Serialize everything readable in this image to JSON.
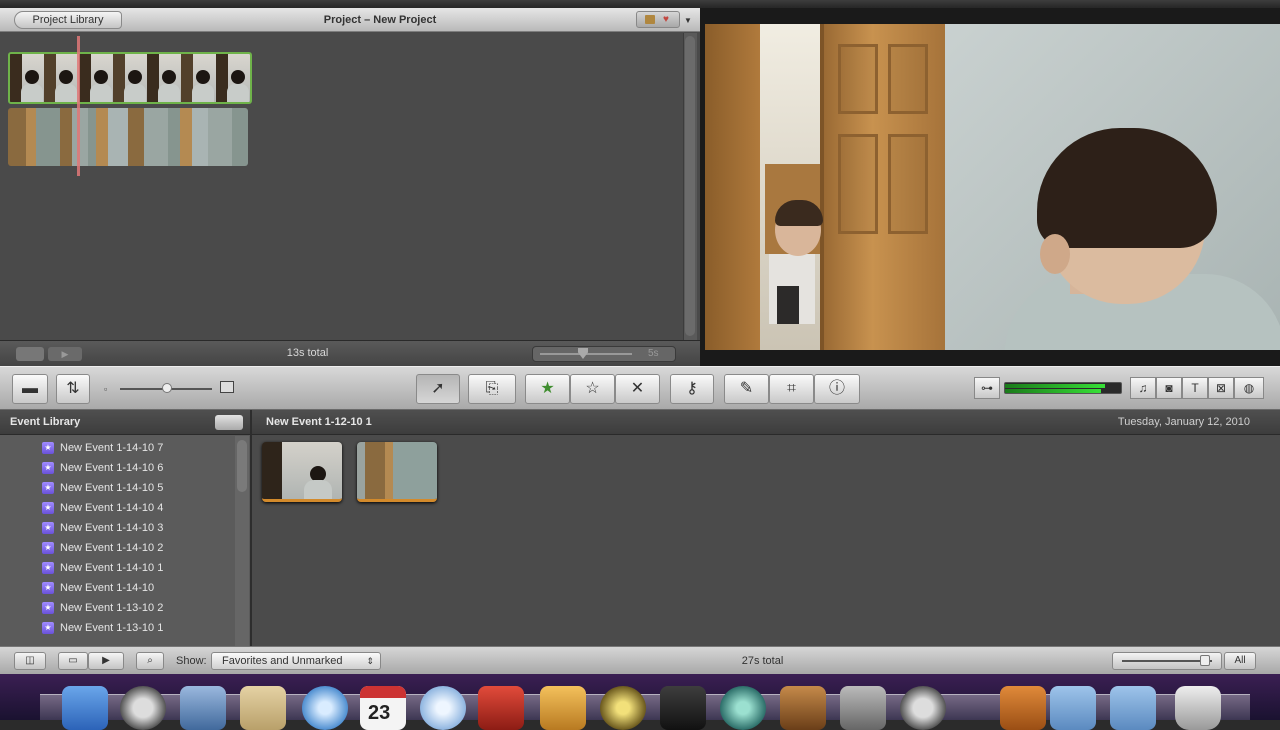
{
  "project": {
    "library_button": "Project Library",
    "title": "Project – New Project",
    "total": "13s total",
    "zoom_label": "5s"
  },
  "event_library": {
    "title": "Event Library",
    "events": [
      "New Event 1-14-10 7",
      "New Event 1-14-10 6",
      "New Event 1-14-10 5",
      "New Event 1-14-10 4",
      "New Event 1-14-10 3",
      "New Event 1-14-10 2",
      "New Event 1-14-10 1",
      "New Event 1-14-10",
      "New Event 1-13-10 2",
      "New Event 1-13-10 1"
    ]
  },
  "event_browser": {
    "name": "New Event 1-12-10 1",
    "date": "Tuesday, January 12, 2010"
  },
  "bottom_bar": {
    "show_label": "Show:",
    "show_value": "Favorites and Unmarked",
    "total": "27s total",
    "all_label": "All"
  },
  "dock": {
    "calendar_day": "23"
  },
  "colors": {
    "selected_clip_border": "#6fb34a",
    "playhead": "#e07878",
    "favorite_star": "#3f8d2f",
    "thumb_underline": "#d38a2b",
    "event_icon": "#7b64e6"
  },
  "icons": {
    "toolbar": [
      "camera-icon",
      "swap-icon",
      "small-thumb-icon",
      "large-thumb-icon",
      "arrow-select-icon",
      "add-to-project-icon",
      "favorite-star-icon",
      "unmark-star-icon",
      "reject-x-icon",
      "keyword-key-icon",
      "eyedropper-icon",
      "crop-icon",
      "info-icon",
      "music-icon",
      "photo-icon",
      "title-icon",
      "transition-icon",
      "map-icon"
    ]
  }
}
